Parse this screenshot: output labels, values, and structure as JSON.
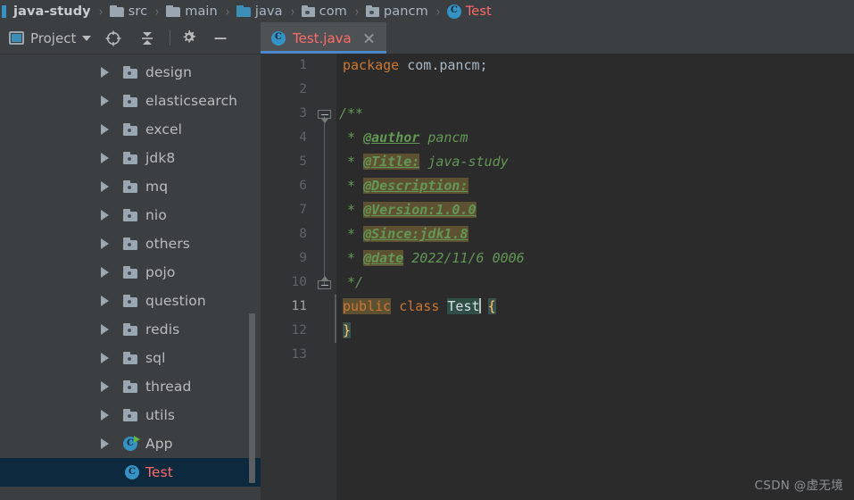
{
  "breadcrumb": {
    "items": [
      {
        "label": "java-study",
        "icon": "folder-icon",
        "style": "bold"
      },
      {
        "label": "src",
        "icon": "folder-icon",
        "style": "plain"
      },
      {
        "label": "main",
        "icon": "folder-icon",
        "style": "plain"
      },
      {
        "label": "java",
        "icon": "folder-icon-blue",
        "style": "plain"
      },
      {
        "label": "com",
        "icon": "package-icon",
        "style": "plain"
      },
      {
        "label": "pancm",
        "icon": "package-icon",
        "style": "plain"
      },
      {
        "label": "Test",
        "icon": "class-icon",
        "style": "class"
      }
    ],
    "separator": "›"
  },
  "sidebar": {
    "title": "Project",
    "toolbar": {
      "project_label": "Project",
      "dropdown_icon": "chevron-down-icon",
      "locate_icon": "crosshair-target-icon",
      "collapse_all_icon": "collapse-all-icon",
      "settings_icon": "gear-icon",
      "hide_icon": "minimize-icon"
    },
    "tree": [
      {
        "label": "design",
        "icon": "module-folder-icon",
        "expandable": true,
        "selected": false
      },
      {
        "label": "elasticsearch",
        "icon": "module-folder-icon",
        "expandable": true,
        "selected": false
      },
      {
        "label": "excel",
        "icon": "module-folder-icon",
        "expandable": true,
        "selected": false
      },
      {
        "label": "jdk8",
        "icon": "module-folder-icon",
        "expandable": true,
        "selected": false
      },
      {
        "label": "mq",
        "icon": "module-folder-icon",
        "expandable": true,
        "selected": false
      },
      {
        "label": "nio",
        "icon": "module-folder-icon",
        "expandable": true,
        "selected": false
      },
      {
        "label": "others",
        "icon": "module-folder-icon",
        "expandable": true,
        "selected": false
      },
      {
        "label": "pojo",
        "icon": "module-folder-icon",
        "expandable": true,
        "selected": false
      },
      {
        "label": "question",
        "icon": "module-folder-icon",
        "expandable": true,
        "selected": false
      },
      {
        "label": "redis",
        "icon": "module-folder-icon",
        "expandable": true,
        "selected": false
      },
      {
        "label": "sql",
        "icon": "module-folder-icon",
        "expandable": true,
        "selected": false
      },
      {
        "label": "thread",
        "icon": "module-folder-icon",
        "expandable": true,
        "selected": false
      },
      {
        "label": "utils",
        "icon": "module-folder-icon",
        "expandable": true,
        "selected": false
      },
      {
        "label": "App",
        "icon": "class-runnable-icon",
        "expandable": true,
        "selected": false
      },
      {
        "label": "Test",
        "icon": "class-icon",
        "expandable": false,
        "selected": true
      }
    ]
  },
  "editor": {
    "tab": {
      "label": "Test.java",
      "icon": "class-icon",
      "close_icon": "close-icon",
      "active": true
    },
    "line_numbers": [
      "1",
      "2",
      "3",
      "4",
      "5",
      "6",
      "7",
      "8",
      "9",
      "10",
      "11",
      "12",
      "13"
    ],
    "code_lines": [
      {
        "n": "1",
        "text": "package com.pancm;"
      },
      {
        "n": "2",
        "text": ""
      },
      {
        "n": "3",
        "text": "/**"
      },
      {
        "n": "4",
        "text": " * @author pancm"
      },
      {
        "n": "5",
        "text": " * @Title: java-study"
      },
      {
        "n": "6",
        "text": " * @Description:"
      },
      {
        "n": "7",
        "text": " * @Version:1.0.0"
      },
      {
        "n": "8",
        "text": " * @Since:jdk1.8"
      },
      {
        "n": "9",
        "text": " * @date 2022/11/6 0006"
      },
      {
        "n": "10",
        "text": " */"
      },
      {
        "n": "11",
        "text": "public class Test {"
      },
      {
        "n": "12",
        "text": "}"
      },
      {
        "n": "13",
        "text": ""
      }
    ],
    "tokens": {
      "kw_package": "package",
      "pkg_name": " com.pancm;",
      "doc_open": "/**",
      "doc_star": " * ",
      "tag_author": "@author",
      "val_author": " pancm",
      "tag_title": "@Title:",
      "val_title": " java-study",
      "tag_description": "@Description:",
      "tag_version": "@Version:1.0.0",
      "tag_since": "@Since:jdk1.8",
      "tag_date": "@date",
      "val_date": " 2022/11/6 0006",
      "doc_close": " */",
      "kw_public": "public",
      "kw_class": "class",
      "cls_name": "Test",
      "brace_open": "{",
      "brace_close": "}"
    }
  },
  "watermark": "CSDN @虚无境",
  "colors": {
    "accent_blue": "#3592c4",
    "tab_underline": "#4a88c7",
    "selection_row": "#0d293e",
    "class_red": "#ff6b68",
    "keyword_orange": "#cc7832",
    "comment_green": "#629755",
    "brace_yellow": "#ffc66d",
    "highlight_olive": "#5d5132",
    "editor_bg": "#2b2b2b",
    "panel_bg": "#3c3f41",
    "gutter_bg": "#313335",
    "run_green": "#62b543"
  }
}
